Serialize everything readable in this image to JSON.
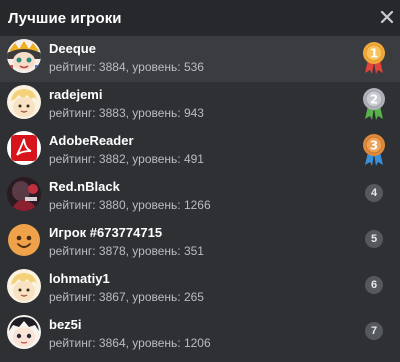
{
  "header": {
    "title": "Лучшие игроки",
    "close_icon": "close-icon"
  },
  "players": [
    {
      "name": "Deeque",
      "stats": "рейтинг: 3884, уровень: 536",
      "rank": "1",
      "badge": "gold-medal-icon",
      "avatar": "anime-avatar"
    },
    {
      "name": "radejemi",
      "stats": "рейтинг: 3883, уровень: 943",
      "rank": "2",
      "badge": "silver-medal-icon",
      "avatar": "cartoon-blond-avatar"
    },
    {
      "name": "AdobeReader",
      "stats": "рейтинг: 3882, уровень: 491",
      "rank": "3",
      "badge": "bronze-medal-icon",
      "avatar": "adobe-reader-logo-avatar"
    },
    {
      "name": "Red.nBlack",
      "stats": "рейтинг: 3880, уровень: 1266",
      "rank": "4",
      "badge": "rank-circle",
      "avatar": "dark-photo-avatar"
    },
    {
      "name": "Игрок #673774715",
      "stats": "рейтинг: 3878, уровень: 351",
      "rank": "5",
      "badge": "rank-circle",
      "avatar": "default-smiley-avatar"
    },
    {
      "name": "lohmatiy1",
      "stats": "рейтинг: 3867, уровень: 265",
      "rank": "6",
      "badge": "rank-circle",
      "avatar": "cartoon-blond-avatar"
    },
    {
      "name": "bez5i",
      "stats": "рейтинг: 3864, уровень: 1206",
      "rank": "7",
      "badge": "rank-circle",
      "avatar": "anime-avatar"
    }
  ],
  "colors": {
    "background": "#2e3033",
    "header": "#26282b",
    "highlight_row": "#3a3c40",
    "stats_text": "#b9bcc0",
    "gold": "#f2a93b",
    "silver": "#b8bcc2",
    "bronze": "#e08a3c",
    "ribbon_red": "#e0443a",
    "ribbon_green": "#58b24a"
  }
}
